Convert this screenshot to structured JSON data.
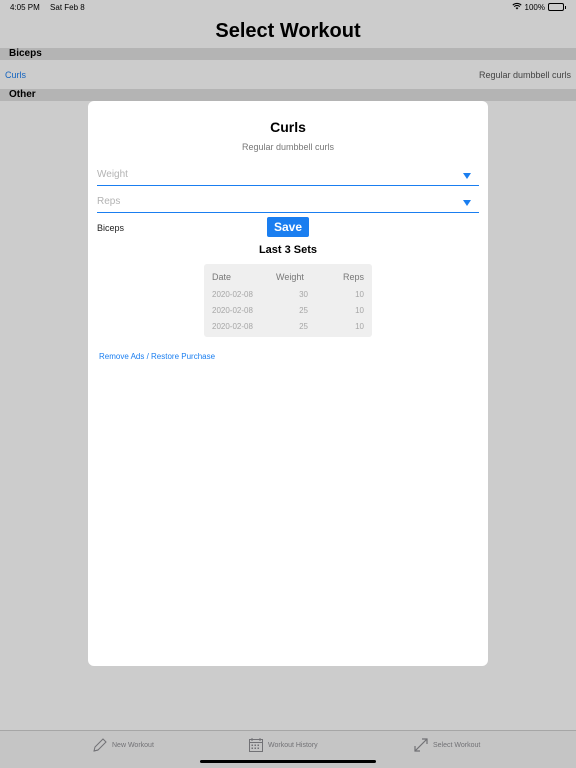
{
  "status_bar": {
    "time": "4:05 PM",
    "date": "Sat Feb 8",
    "battery_label": "100%",
    "battery_level": 1.0
  },
  "nav": {
    "title": "Select Workout"
  },
  "sections": [
    {
      "name": "Biceps",
      "rows": [
        {
          "title": "Curls",
          "subtitle": "Regular dumbbell curls"
        }
      ]
    },
    {
      "name": "Other",
      "rows": []
    }
  ],
  "modal": {
    "title": "Curls",
    "subtitle": "Regular dumbbell curls",
    "weight_placeholder": "Weight",
    "reps_placeholder": "Reps",
    "category": "Biceps",
    "save_label": "Save",
    "sets_title": "Last 3 Sets",
    "table": {
      "headers": [
        "Date",
        "Weight",
        "Reps"
      ],
      "rows": [
        [
          "2020-02-08",
          "30",
          "10"
        ],
        [
          "2020-02-08",
          "25",
          "10"
        ],
        [
          "2020-02-08",
          "25",
          "10"
        ]
      ]
    },
    "remove_ads_label": "Remove Ads / Restore Purchase"
  },
  "tabbar": {
    "items": [
      {
        "label": "New Workout",
        "icon": "pencil-icon"
      },
      {
        "label": "Workout History",
        "icon": "calendar-icon"
      },
      {
        "label": "Select Workout",
        "icon": "arrows-icon"
      }
    ]
  },
  "colors": {
    "accent": "#1a7ef0",
    "section_header_bg": "#e1e1e1",
    "table_bg": "#efefef"
  }
}
